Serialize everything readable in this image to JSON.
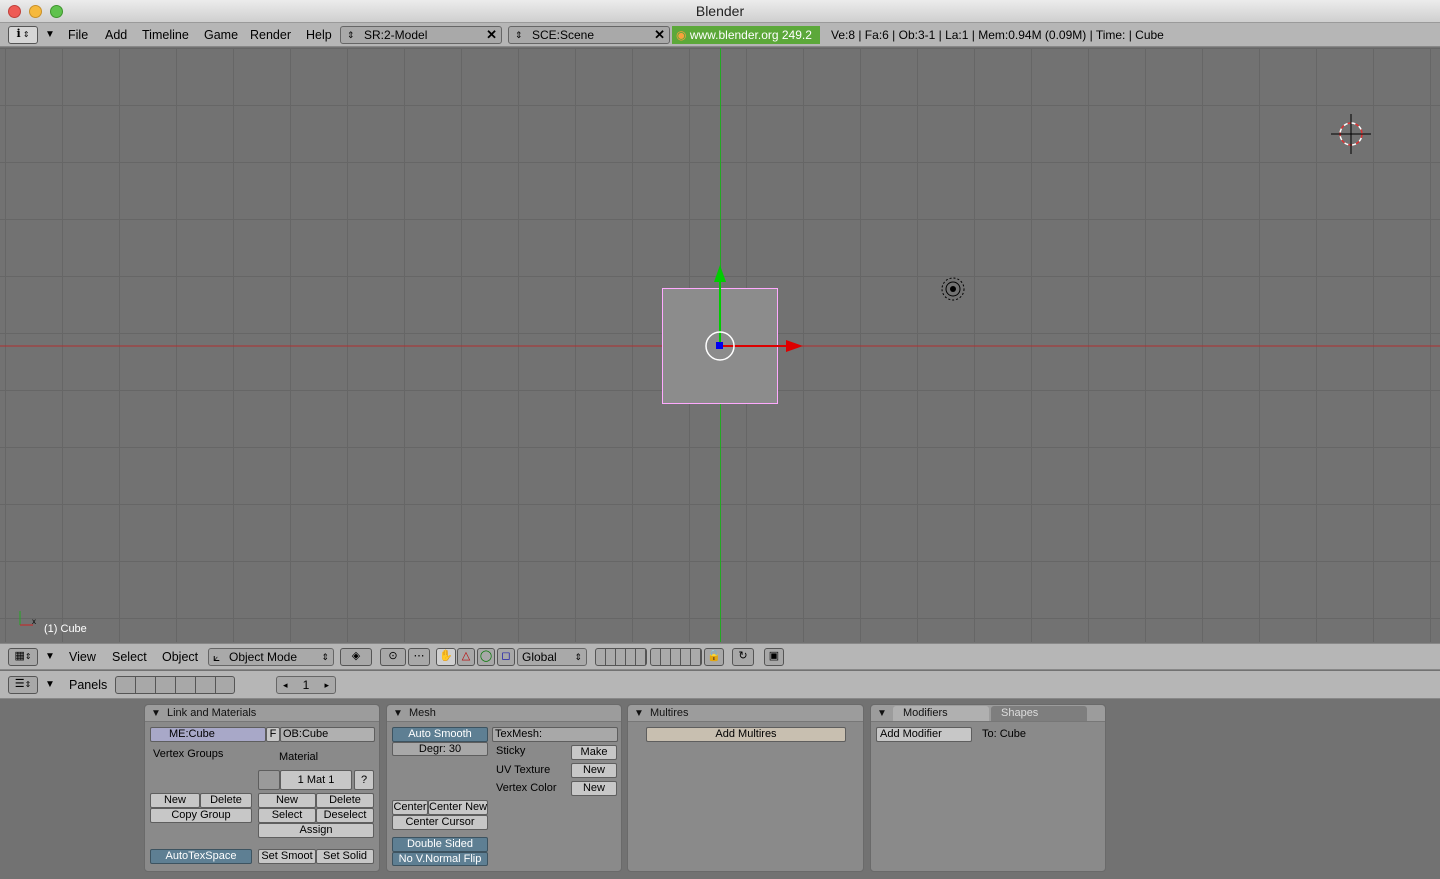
{
  "window": {
    "title": "Blender"
  },
  "infobar": {
    "menus": [
      "File",
      "Add",
      "Timeline",
      "Game",
      "Render",
      "Help"
    ],
    "screen_field": "SR:2-Model",
    "scene_field": "SCE:Scene",
    "version": "www.blender.org 249.2",
    "stats": "Ve:8 | Fa:6 | Ob:3-1 | La:1  | Mem:0.94M (0.09M) | Time: | Cube"
  },
  "viewport": {
    "object_label": "(1) Cube"
  },
  "header3d": {
    "menus": [
      "View",
      "Select",
      "Object"
    ],
    "mode": "Object Mode",
    "orientation": "Global"
  },
  "buttons_header": {
    "label": "Panels",
    "frame": "1"
  },
  "panels": {
    "link_materials": {
      "title": "Link and Materials",
      "mesh_name": "ME:Cube",
      "f_label": "F",
      "object_name": "OB:Cube",
      "vertex_groups": "Vertex Groups",
      "material": "Material",
      "mat_index": "1 Mat 1",
      "q": "?",
      "vg_new": "New",
      "vg_delete": "Delete",
      "copy_group": "Copy Group",
      "mat_new": "New",
      "mat_delete": "Delete",
      "mat_select": "Select",
      "mat_deselect": "Deselect",
      "assign": "Assign",
      "autotexspace": "AutoTexSpace",
      "set_smooth": "Set Smoot",
      "set_solid": "Set Solid"
    },
    "mesh": {
      "title": "Mesh",
      "auto_smooth": "Auto Smooth",
      "degr": "Degr: 30",
      "texmesh": "TexMesh:",
      "sticky": "Sticky",
      "sticky_btn": "Make",
      "uv_texture": "UV Texture",
      "uv_btn": "New",
      "vertex_color": "Vertex Color",
      "vc_btn": "New",
      "center": "Center",
      "center_new": "Center New",
      "center_cursor": "Center Cursor",
      "double_sided": "Double Sided",
      "no_vnormal_flip": "No V.Normal Flip"
    },
    "multires": {
      "title": "Multires",
      "add": "Add Multires"
    },
    "modifiers": {
      "tab1": "Modifiers",
      "tab2": "Shapes",
      "add": "Add Modifier",
      "to": "To: Cube"
    }
  },
  "colors": {
    "x_axis": "#cc0000",
    "y_axis": "#00aa00",
    "select_outline": "#ffaaff",
    "version_bg": "#5ca83a"
  }
}
